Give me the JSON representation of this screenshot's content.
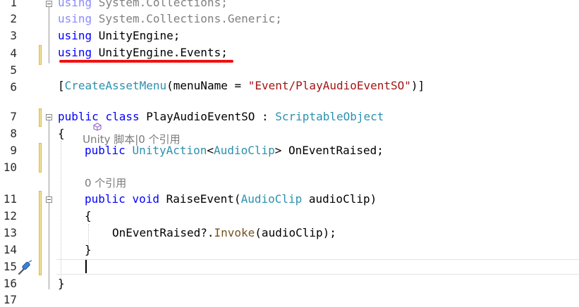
{
  "editor": {
    "line_numbers": [
      "1",
      "2",
      "3",
      "4",
      "5",
      "6",
      "7",
      "8",
      "9",
      "10",
      "11",
      "12",
      "13",
      "14",
      "15",
      "16",
      "17"
    ],
    "lines": {
      "l1": {
        "kw": "using",
        "rest": " System.Collections;"
      },
      "l2": {
        "kw": "using",
        "rest": " System.Collections.Generic;"
      },
      "l3": {
        "kw": "using",
        "rest": " UnityEngine;"
      },
      "l4": {
        "kw": "using",
        "rest": " UnityEngine.Events;"
      },
      "l6": {
        "open": "[",
        "attr": "CreateAssetMenu",
        "mid": "(menuName = ",
        "str": "\"Event/PlayAudioEventSO\"",
        "close": ")]"
      },
      "lens1": "Unity 脚本|0 个引用",
      "l7": {
        "kw1": "public",
        "kw2": "class",
        "name": " PlayAudioEventSO : ",
        "base": "ScriptableObject"
      },
      "l8": "{",
      "l9": {
        "kw": "public",
        "type": "UnityAction",
        "lt": "<",
        "arg": "AudioClip",
        "rest": "> OnEventRaised;"
      },
      "lens2": "0 个引用",
      "l11": {
        "kw1": "public",
        "kw2": "void",
        "name": " RaiseEvent(",
        "type": "AudioClip",
        "rest": " audioClip)"
      },
      "l12": "{",
      "l13": {
        "pre": "OnEventRaised?.",
        "call": "Invoke",
        "rest": "(audioClip);"
      },
      "l14": "}",
      "l16": "}"
    },
    "icons": {
      "unity": "unity-icon",
      "quick_actions": "screwdriver-icon"
    }
  }
}
